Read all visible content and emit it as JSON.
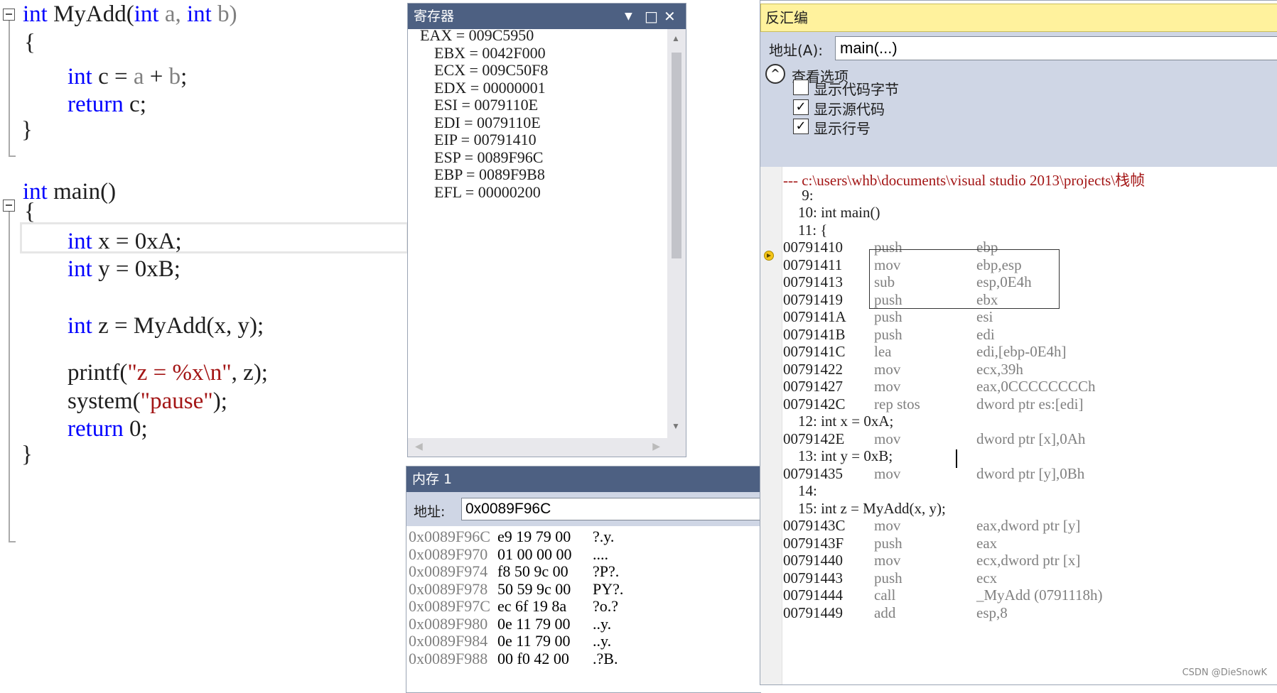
{
  "editor": {
    "lines": [
      {
        "segments": [
          {
            "t": "int",
            "c": "kw"
          },
          {
            "t": " MyAdd(",
            "c": ""
          },
          {
            "t": "int",
            "c": "kw"
          },
          {
            "t": " a, ",
            "c": "param"
          },
          {
            "t": "int",
            "c": "kw"
          },
          {
            "t": " b)",
            "c": "param"
          }
        ]
      },
      {
        "segments": [
          {
            "t": "{",
            "c": ""
          }
        ]
      },
      {
        "segments": [
          {
            "t": "int",
            "c": "kw"
          },
          {
            "t": " c = ",
            "c": ""
          },
          {
            "t": "a",
            "c": "param"
          },
          {
            "t": " + ",
            "c": ""
          },
          {
            "t": "b",
            "c": "param"
          },
          {
            "t": ";",
            "c": ""
          }
        ]
      },
      {
        "segments": [
          {
            "t": "return",
            "c": "kw"
          },
          {
            "t": " c;",
            "c": ""
          }
        ]
      },
      {
        "segments": [
          {
            "t": "}",
            "c": ""
          }
        ]
      },
      {
        "segments": [
          {
            "t": "int",
            "c": "kw"
          },
          {
            "t": " main()",
            "c": ""
          }
        ]
      },
      {
        "segments": [
          {
            "t": "{",
            "c": ""
          }
        ]
      },
      {
        "segments": [
          {
            "t": "int",
            "c": "kw"
          },
          {
            "t": " x = 0xA;",
            "c": ""
          }
        ]
      },
      {
        "segments": [
          {
            "t": "int",
            "c": "kw"
          },
          {
            "t": " y = 0xB;",
            "c": ""
          }
        ]
      },
      {
        "segments": [
          {
            "t": "int",
            "c": "kw"
          },
          {
            "t": " z = MyAdd(x, y);",
            "c": ""
          }
        ]
      },
      {
        "segments": [
          {
            "t": "printf(",
            "c": ""
          },
          {
            "t": "\"z = %x\\n\"",
            "c": "str"
          },
          {
            "t": ", z);",
            "c": ""
          }
        ]
      },
      {
        "segments": [
          {
            "t": "system(",
            "c": ""
          },
          {
            "t": "\"pause\"",
            "c": "str"
          },
          {
            "t": ");",
            "c": ""
          }
        ]
      },
      {
        "segments": [
          {
            "t": "return",
            "c": "kw"
          },
          {
            "t": " 0;",
            "c": ""
          }
        ]
      },
      {
        "segments": [
          {
            "t": "}",
            "c": ""
          }
        ]
      }
    ]
  },
  "registers": {
    "title": "寄存器",
    "rows": [
      "EAX = 009C5950",
      "EBX = 0042F000",
      "ECX = 009C50F8",
      "EDX = 00000001",
      "ESI = 0079110E",
      "EDI = 0079110E",
      "EIP = 00791410",
      "ESP = 0089F96C",
      "EBP = 0089F9B8",
      "EFL = 00000200"
    ]
  },
  "memory": {
    "title": "内存 1",
    "address_label": "地址:",
    "address_value": "0x0089F96C",
    "rows": [
      {
        "addr": "0x0089F96C",
        "bytes": "e9 19 79 00",
        "ascii": "?.y."
      },
      {
        "addr": "0x0089F970",
        "bytes": "01 00 00 00",
        "ascii": "...."
      },
      {
        "addr": "0x0089F974",
        "bytes": "f8 50 9c 00",
        "ascii": "?P?."
      },
      {
        "addr": "0x0089F978",
        "bytes": "50 59 9c 00",
        "ascii": "PY?."
      },
      {
        "addr": "0x0089F97C",
        "bytes": "ec 6f 19 8a",
        "ascii": "?o.?"
      },
      {
        "addr": "0x0089F980",
        "bytes": "0e 11 79 00",
        "ascii": "..y."
      },
      {
        "addr": "0x0089F984",
        "bytes": "0e 11 79 00",
        "ascii": "..y."
      },
      {
        "addr": "0x0089F988",
        "bytes": "00 f0 42 00",
        "ascii": ".?B."
      }
    ]
  },
  "disassembly": {
    "title": "反汇编",
    "address_label": "地址(A):",
    "address_value": "main(...)",
    "options_header": "查看选项",
    "options": [
      {
        "label": "显示代码字节",
        "checked": false
      },
      {
        "label": "显示源代码",
        "checked": true
      },
      {
        "label": "显示行号",
        "checked": true
      }
    ],
    "lines": [
      {
        "type": "path",
        "text": "--- c:\\users\\whb\\documents\\visual studio 2013\\projects\\栈帧"
      },
      {
        "type": "src",
        "text": "     9:"
      },
      {
        "type": "src",
        "text": "    10: int main()"
      },
      {
        "type": "src",
        "text": "    11: {"
      },
      {
        "type": "asm",
        "addr": "00791410",
        "op": "push",
        "arg": "ebp"
      },
      {
        "type": "asm",
        "addr": "00791411",
        "op": "mov",
        "arg": "ebp,esp"
      },
      {
        "type": "asm",
        "addr": "00791413",
        "op": "sub",
        "arg": "esp,0E4h"
      },
      {
        "type": "asm",
        "addr": "00791419",
        "op": "push",
        "arg": "ebx"
      },
      {
        "type": "asm",
        "addr": "0079141A",
        "op": "push",
        "arg": "esi"
      },
      {
        "type": "asm",
        "addr": "0079141B",
        "op": "push",
        "arg": "edi"
      },
      {
        "type": "asm",
        "addr": "0079141C",
        "op": "lea",
        "arg": "edi,[ebp-0E4h]"
      },
      {
        "type": "asm",
        "addr": "00791422",
        "op": "mov",
        "arg": "ecx,39h"
      },
      {
        "type": "asm",
        "addr": "00791427",
        "op": "mov",
        "arg": "eax,0CCCCCCCCh"
      },
      {
        "type": "asm",
        "addr": "0079142C",
        "op": "rep stos",
        "arg": "dword ptr es:[edi]"
      },
      {
        "type": "src",
        "text": "    12: int x = 0xA;"
      },
      {
        "type": "asm",
        "addr": "0079142E",
        "op": "mov",
        "arg": "dword ptr [x],0Ah"
      },
      {
        "type": "src",
        "text": "    13: int y = 0xB;"
      },
      {
        "type": "asm",
        "addr": "00791435",
        "op": "mov",
        "arg": "dword ptr [y],0Bh"
      },
      {
        "type": "src",
        "text": "    14:"
      },
      {
        "type": "src",
        "text": "    15: int z = MyAdd(x, y);"
      },
      {
        "type": "asm",
        "addr": "0079143C",
        "op": "mov",
        "arg": "eax,dword ptr [y]"
      },
      {
        "type": "asm",
        "addr": "0079143F",
        "op": "push",
        "arg": "eax"
      },
      {
        "type": "asm",
        "addr": "00791440",
        "op": "mov",
        "arg": "ecx,dword ptr [x]"
      },
      {
        "type": "asm",
        "addr": "00791443",
        "op": "push",
        "arg": "ecx"
      },
      {
        "type": "asm",
        "addr": "00791444",
        "op": "call",
        "arg": "_MyAdd (0791118h)"
      },
      {
        "type": "asm",
        "addr": "00791449",
        "op": "add",
        "arg": "esp,8"
      }
    ]
  },
  "watermark": "CSDN @DieSnowK"
}
